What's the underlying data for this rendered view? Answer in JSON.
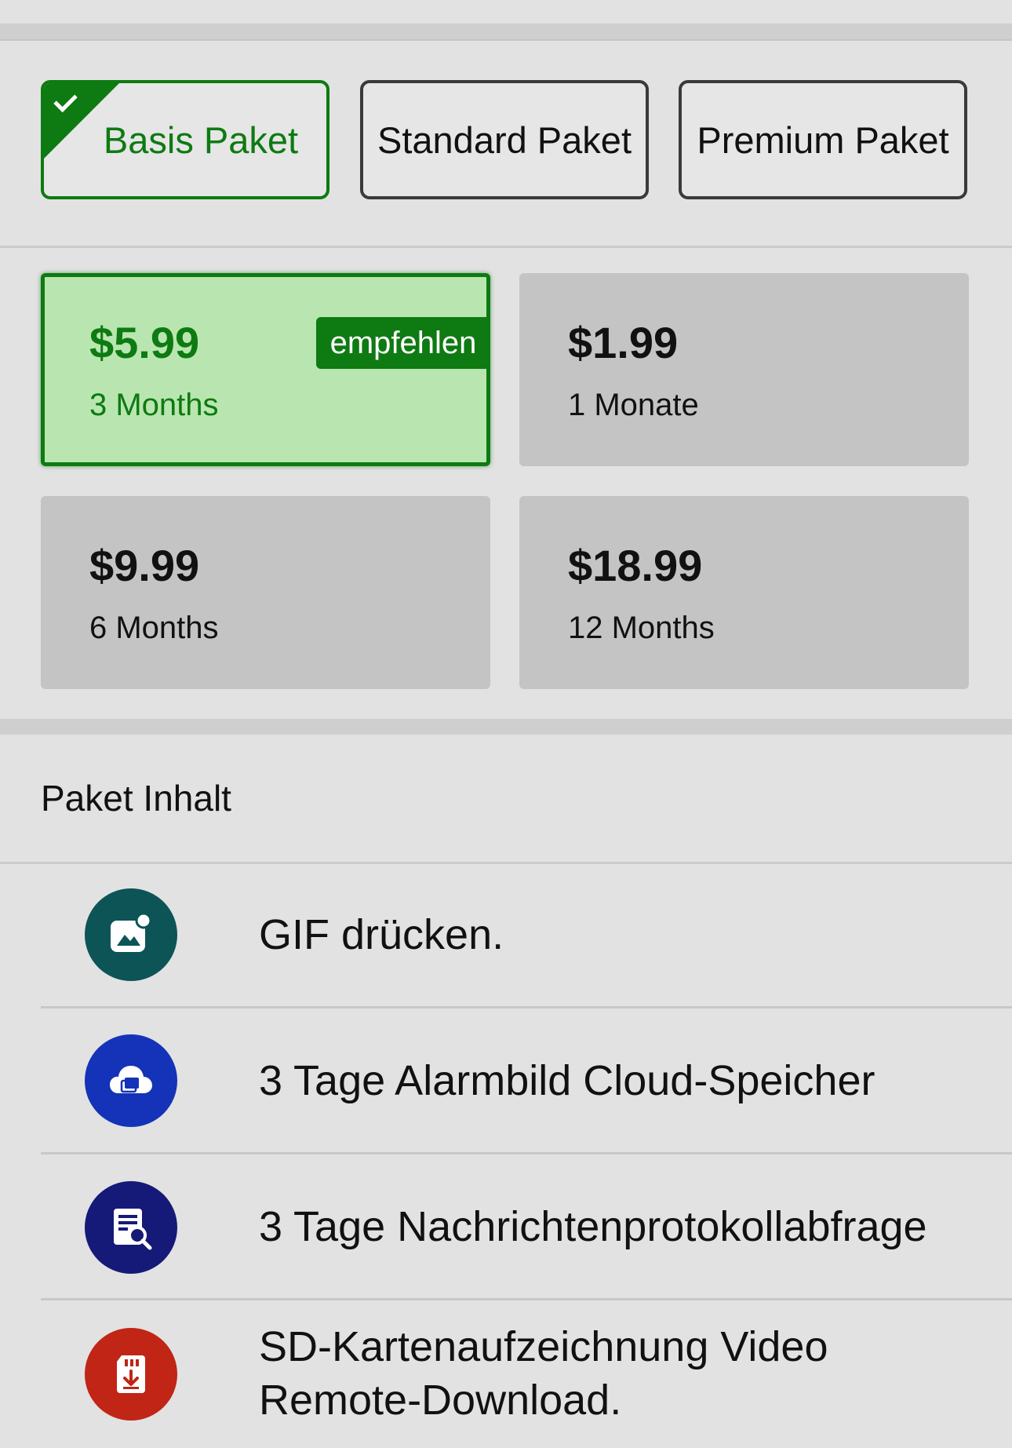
{
  "packages": [
    {
      "label": "Basis Paket",
      "selected": true
    },
    {
      "label": "Standard Paket",
      "selected": false
    },
    {
      "label": "Premium Paket",
      "selected": false
    }
  ],
  "durations": [
    {
      "price": "$5.99",
      "period": "3 Months",
      "badge": "empfehlen",
      "selected": true
    },
    {
      "price": "$1.99",
      "period": "1 Monate",
      "selected": false
    },
    {
      "price": "$9.99",
      "period": "6 Months",
      "selected": false
    },
    {
      "price": "$18.99",
      "period": "12 Months",
      "selected": false
    }
  ],
  "contents": {
    "title": "Paket Inhalt",
    "features": [
      {
        "icon": "gif-image-icon",
        "color": "#0d5456",
        "lines": [
          "GIF drücken."
        ]
      },
      {
        "icon": "cloud-image-icon",
        "color": "#1433b8",
        "lines": [
          "3 Tage Alarmbild Cloud-Speicher"
        ]
      },
      {
        "icon": "log-search-icon",
        "color": "#151a78",
        "lines": [
          "3 Tage Nachrichtenprotokollabfrage"
        ]
      },
      {
        "icon": "sd-card-download-icon",
        "color": "#c02516",
        "lines": [
          "SD-Kartenaufzeichnung Video",
          "Remote-Download."
        ]
      }
    ]
  },
  "colors": {
    "accent": "#0e7a12",
    "selected_card_bg": "#b9e6b0",
    "card_bg": "#c4c4c4",
    "page_bg": "#e2e2e2"
  }
}
